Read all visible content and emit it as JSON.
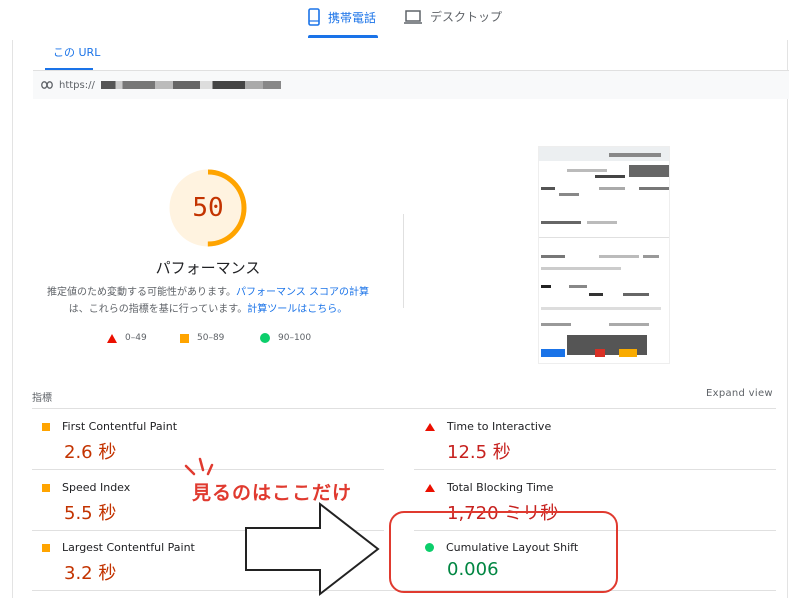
{
  "tabs": {
    "mobile_label": "携帯電話",
    "desktop_label": "デスクトップ"
  },
  "url_section": {
    "tab_label": "この URL",
    "url_prefix": "https://"
  },
  "score": {
    "value": "50",
    "fraction": 0.5,
    "label": "パフォーマンス",
    "desc_1": "推定値のため変動する可能性があります。",
    "desc_link_1": "パフォーマンス スコアの計算",
    "desc_2": "は、これらの指標を基に行っています。",
    "desc_link_2": "計算ツールはこちら。"
  },
  "legend": {
    "poor": "0–49",
    "average": "50–89",
    "good": "90–100"
  },
  "metrics": {
    "title": "指標",
    "expand_label": "Expand view",
    "items": [
      {
        "label": "First Contentful Paint",
        "value": "2.6 秒",
        "status": "average"
      },
      {
        "label": "Time to Interactive",
        "value": "12.5 秒",
        "status": "poor"
      },
      {
        "label": "Speed Index",
        "value": "5.5 秒",
        "status": "average"
      },
      {
        "label": "Total Blocking Time",
        "value": "1,720 ミリ秒",
        "status": "poor"
      },
      {
        "label": "Largest Contentful Paint",
        "value": "3.2 秒",
        "status": "average"
      },
      {
        "label": "Cumulative Layout Shift",
        "value": "0.006",
        "status": "good"
      }
    ]
  },
  "annotation": {
    "text": "見るのはここだけ"
  },
  "colors": {
    "accent": "#1a73e8",
    "poor": "#eb0f00",
    "average": "#ffa400",
    "good": "#0cce6b",
    "annotation": "#e03a2f"
  }
}
